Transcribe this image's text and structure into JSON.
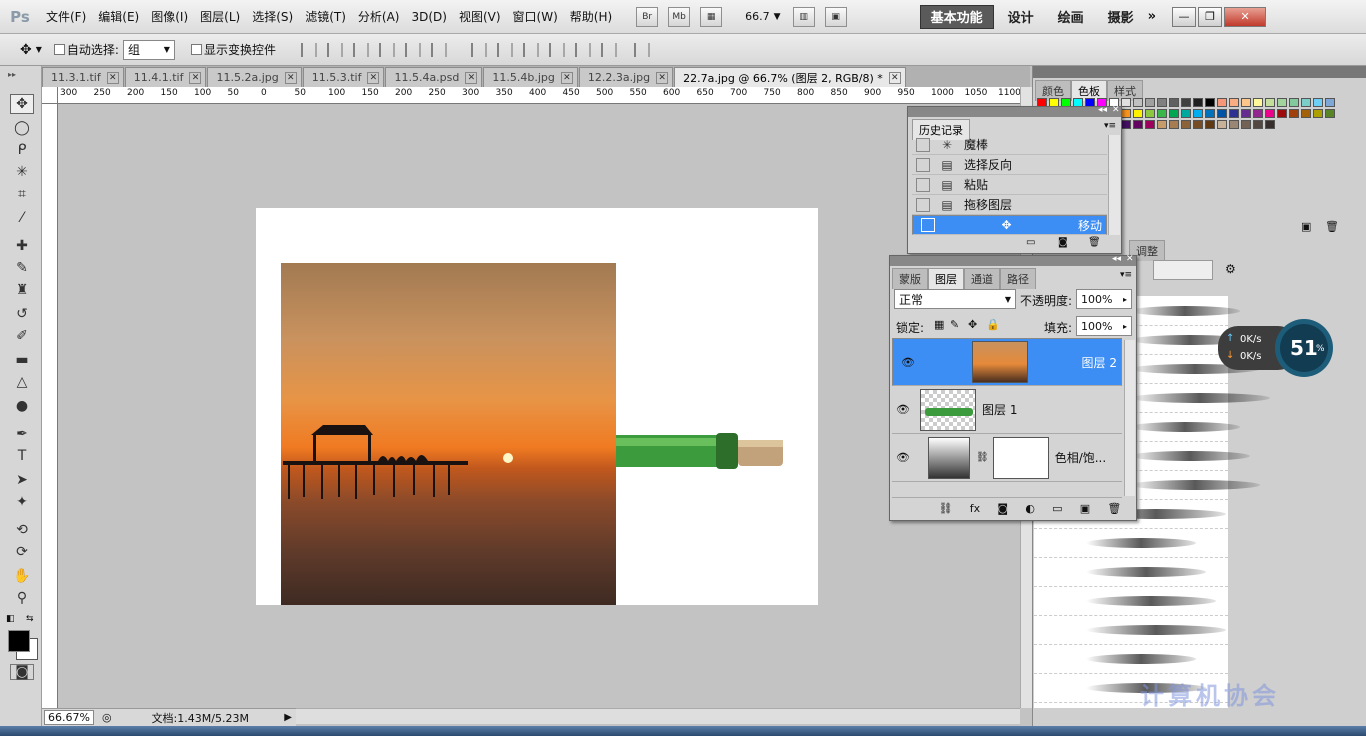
{
  "app": {
    "logo": "Ps"
  },
  "menu": [
    "文件(F)",
    "编辑(E)",
    "图像(I)",
    "图层(L)",
    "选择(S)",
    "滤镜(T)",
    "分析(A)",
    "3D(D)",
    "视图(V)",
    "窗口(W)",
    "帮助(H)"
  ],
  "appbar": {
    "bridge": "Br",
    "mini_bridge": "Mb",
    "zoom": "66.7"
  },
  "workspaces": [
    "基本功能",
    "设计",
    "绘画",
    "摄影"
  ],
  "options": {
    "auto_select_label": "自动选择:",
    "auto_select_value": "组",
    "show_transform_label": "显示变换控件"
  },
  "tabs": [
    "11.3.1.tif",
    "11.4.1.tif",
    "11.5.2a.jpg",
    "11.5.3.tif",
    "11.5.4a.psd",
    "11.5.4b.jpg",
    "12.2.3a.jpg",
    "22.7a.jpg @ 66.7% (图层 2, RGB/8) *"
  ],
  "ruler_ticks": [
    "300",
    "250",
    "200",
    "150",
    "100",
    "50",
    "0",
    "50",
    "100",
    "150",
    "200",
    "250",
    "300",
    "350",
    "400",
    "450",
    "500",
    "550",
    "600",
    "650",
    "700",
    "750",
    "800",
    "850",
    "900",
    "950",
    "1000",
    "1050",
    "1100"
  ],
  "status": {
    "zoom": "66.67%",
    "doc": "文档:1.43M/5.23M"
  },
  "swatches_panel": {
    "tabs": [
      "颜色",
      "色板",
      "样式"
    ]
  },
  "history": {
    "title": "历史记录",
    "items": [
      "魔棒",
      "选择反向",
      "粘贴",
      "拖移图层",
      "移动"
    ]
  },
  "layers": {
    "tabs": [
      "蒙版",
      "图层",
      "通道",
      "路径"
    ],
    "blend_mode": "正常",
    "opacity_label": "不透明度:",
    "opacity": "100%",
    "lock_label": "锁定:",
    "fill_label": "填充:",
    "fill": "100%",
    "items": [
      "图层 2",
      "图层 1",
      "色相/饱..."
    ]
  },
  "adjust_tab": "调整",
  "speed_widget": {
    "up": "0K/s",
    "down": "0K/s",
    "percent": "51"
  },
  "watermark": "计算机协会",
  "colors": {
    "accent": "#3c8ef5",
    "selected_ws": "#5a5a5a"
  }
}
